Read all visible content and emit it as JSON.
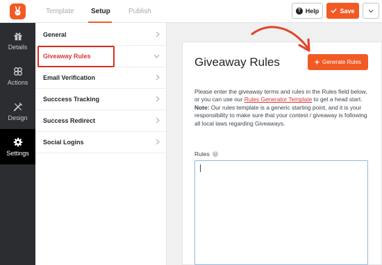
{
  "tabs": [
    {
      "label": "Template"
    },
    {
      "label": "Setup"
    },
    {
      "label": "Publish"
    }
  ],
  "header": {
    "help_label": "Help",
    "save_label": "Save"
  },
  "rail": {
    "items": [
      {
        "label": "Details"
      },
      {
        "label": "Actions"
      },
      {
        "label": "Design"
      },
      {
        "label": "Settings"
      }
    ]
  },
  "panel": {
    "items": [
      {
        "label": "General"
      },
      {
        "label": "Giveaway Rules"
      },
      {
        "label": "Email Verification"
      },
      {
        "label": "Succcess Tracking"
      },
      {
        "label": "Success Redirect"
      },
      {
        "label": "Social Logins"
      }
    ]
  },
  "main": {
    "title": "Giveaway Rules",
    "generate_label": "Generate Rules",
    "desc_part1": "Please enter the giveaway terms and rules in the Rules field below, or you can use our ",
    "desc_link": "Rules Generator Template",
    "desc_part2": " to get a head start.",
    "note_label": "Note:",
    "note_text": " Our rules template is a generic starting point, and it is your responsibility to make sure that your contest / giveaway is following all local laws regarding Giveaways.",
    "rules_label": "Rules",
    "rules_value": ""
  },
  "colors": {
    "accent": "#f15a24",
    "highlight": "#d32f1f",
    "rail_bg": "#2b2d30"
  }
}
